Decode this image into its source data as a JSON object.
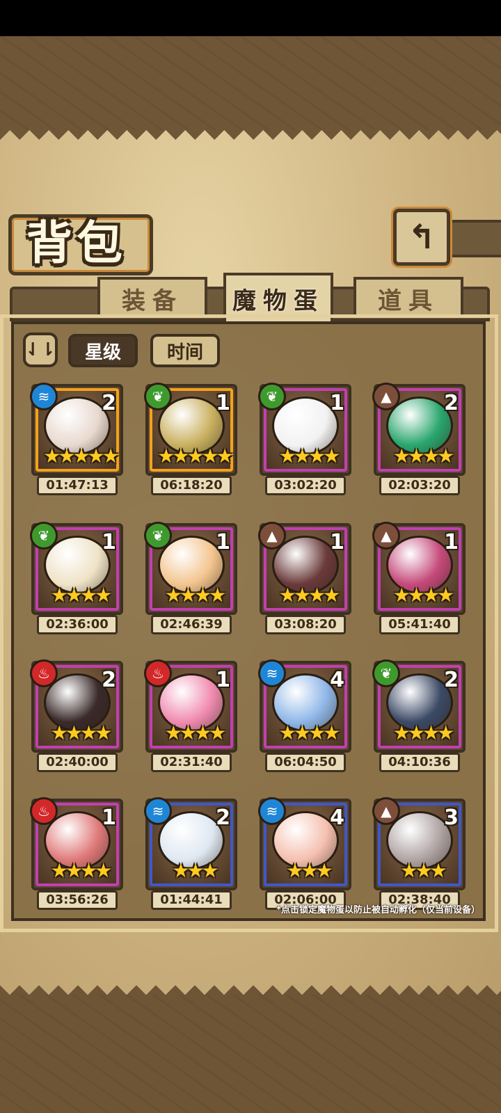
{
  "title": "背包",
  "tabs": [
    {
      "label": "装备",
      "active": false
    },
    {
      "label": "魔物蛋",
      "active": true
    },
    {
      "label": "道具",
      "active": false
    }
  ],
  "sort": {
    "toggle_icon": "sort-order-icon",
    "toggle_label": "⇃⇂",
    "options": [
      {
        "label": "星级",
        "active": true
      },
      {
        "label": "时间",
        "active": false
      }
    ]
  },
  "eggs": [
    {
      "element": "water",
      "count": "2",
      "stars": "★★★★★",
      "time": "01:47:13",
      "rarity": "gold",
      "art_color": "#e8d9cf"
    },
    {
      "element": "grass",
      "count": "1",
      "stars": "★★★★★",
      "time": "06:18:20",
      "rarity": "gold",
      "art_color": "#c9b060"
    },
    {
      "element": "grass",
      "count": "1",
      "stars": "★★★★",
      "time": "03:02:20",
      "rarity": "purple",
      "art_color": "#f2f2f2"
    },
    {
      "element": "earth",
      "count": "2",
      "stars": "★★★★",
      "time": "02:03:20",
      "rarity": "purple",
      "art_color": "#2aa66e"
    },
    {
      "element": "grass",
      "count": "1",
      "stars": "★★★★",
      "time": "02:36:00",
      "rarity": "purple",
      "art_color": "#efe3c7"
    },
    {
      "element": "grass",
      "count": "1",
      "stars": "★★★★",
      "time": "02:46:39",
      "rarity": "purple",
      "art_color": "#f3c58f"
    },
    {
      "element": "earth",
      "count": "1",
      "stars": "★★★★",
      "time": "03:08:20",
      "rarity": "purple",
      "art_color": "#6a3a3a"
    },
    {
      "element": "earth",
      "count": "1",
      "stars": "★★★★",
      "time": "05:41:40",
      "rarity": "purple",
      "art_color": "#c54a7a"
    },
    {
      "element": "fire",
      "count": "2",
      "stars": "★★★★",
      "time": "02:40:00",
      "rarity": "purple",
      "art_color": "#3a2a2a"
    },
    {
      "element": "fire",
      "count": "1",
      "stars": "★★★★",
      "time": "02:31:40",
      "rarity": "purple",
      "art_color": "#f08bb0"
    },
    {
      "element": "water",
      "count": "4",
      "stars": "★★★★",
      "time": "06:04:50",
      "rarity": "purple",
      "art_color": "#8fb7e8"
    },
    {
      "element": "grass",
      "count": "2",
      "stars": "★★★★",
      "time": "04:10:36",
      "rarity": "purple",
      "art_color": "#3c4a66"
    },
    {
      "element": "fire",
      "count": "1",
      "stars": "★★★★",
      "time": "03:56:26",
      "rarity": "purple",
      "art_color": "#e07a7a"
    },
    {
      "element": "water",
      "count": "2",
      "stars": "★★★",
      "time": "01:44:41",
      "rarity": "blue",
      "art_color": "#dfe8f2"
    },
    {
      "element": "water",
      "count": "4",
      "stars": "★★★",
      "time": "02:06:00",
      "rarity": "blue",
      "art_color": "#f5c0b0"
    },
    {
      "element": "earth",
      "count": "3",
      "stars": "★★★",
      "time": "02:38:40",
      "rarity": "blue",
      "art_color": "#b0a4a4"
    }
  ],
  "footnote": "*点击锁定魔物蛋以防止被自动孵化（仅当前设备）",
  "colors": {
    "gold": "#f2a21c",
    "purple": "#c23fb2",
    "blue": "#3f58c9",
    "water": "#1f86d6",
    "grass": "#3f9a2e",
    "earth": "#7d4f3a",
    "fire": "#d3282a"
  },
  "element_glyphs": {
    "water": "≋",
    "grass": "❦",
    "earth": "▲",
    "fire": "♨"
  }
}
